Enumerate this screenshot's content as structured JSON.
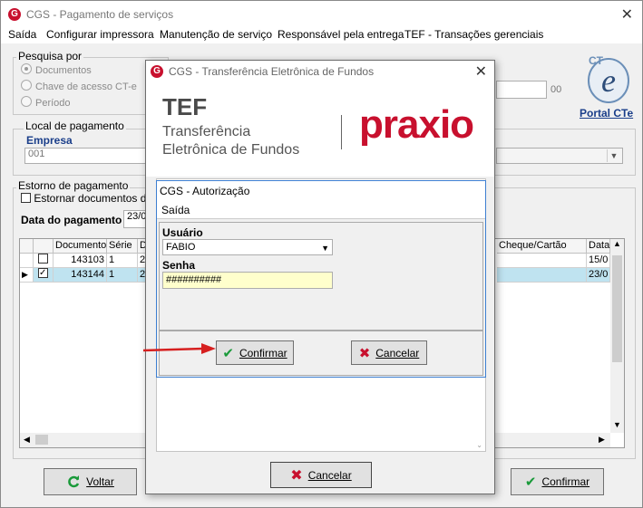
{
  "main": {
    "title": "CGS - Pagamento de serviços",
    "menu": [
      "Saída",
      "Configurar impressora",
      "Manutenção de serviço",
      "Responsável pela entrega",
      "TEF - Transações gerenciais"
    ],
    "pesquisa": {
      "legend": "Pesquisa por",
      "options": [
        "Documentos",
        "Chave de acesso CT-e",
        "Período"
      ],
      "suffix": "00"
    },
    "portal_link": "Portal CTe",
    "cte_logo_text": "CT-e",
    "local": {
      "legend": "Local de pagamento",
      "empresa_label": "Empresa",
      "empresa_value": "001"
    },
    "estorno": {
      "legend": "Estorno de pagamento",
      "checkbox_label": "Estornar documentos de ap",
      "data_label": "Data do pagamento",
      "data_value": "23/0"
    },
    "grid": {
      "headers": [
        "Documento",
        "Série",
        "D",
        "Cheque/Cartão",
        "Data"
      ],
      "rows": [
        {
          "documento": "143103",
          "serie": "1",
          "d": "2",
          "data": "15/0",
          "checked": false
        },
        {
          "documento": "143144",
          "serie": "1",
          "d": "2",
          "data": "23/0",
          "checked": true
        }
      ]
    },
    "voltar_label": "Voltar",
    "confirmar_label": "Confirmar"
  },
  "tef": {
    "title": "CGS - Transferência Eletrônica de Fundos",
    "banner_title": "TEF",
    "banner_line1": "Transferência",
    "banner_line2": "Eletrônica de Fundos",
    "brand": "praxio",
    "cancelar_label": "Cancelar"
  },
  "auth": {
    "title": "CGS - Autorização",
    "menu": "Saída",
    "usuario_label": "Usuário",
    "usuario_value": "FABIO",
    "senha_label": "Senha",
    "senha_value": "##########",
    "confirmar_label": "Confirmar",
    "cancelar_label": "Cancelar"
  },
  "colors": {
    "brand_red": "#c8102e",
    "selected_row": "#bfe3f0",
    "link_blue": "#1a3e8a",
    "arrow": "#d62020"
  }
}
